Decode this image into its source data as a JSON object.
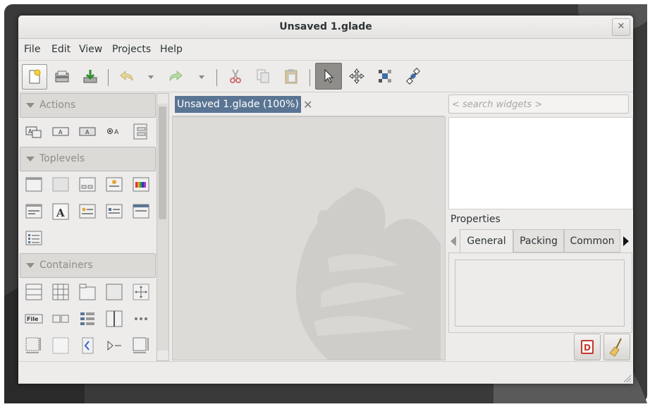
{
  "window": {
    "title": "Unsaved 1.glade",
    "close_glyph": "✕"
  },
  "menu": [
    "File",
    "Edit",
    "View",
    "Projects",
    "Help"
  ],
  "toolbar": {
    "buttons": [
      "new-icon",
      "open-icon",
      "save-icon",
      "undo-icon",
      "redo-icon",
      "cut-icon",
      "copy-icon",
      "paste-icon",
      "select-pointer-icon",
      "drag-resize-icon",
      "margin-edit-icon",
      "alignment-edit-icon"
    ],
    "active": "select-pointer-icon"
  },
  "palette": {
    "sections": [
      {
        "label": "Actions",
        "icons": [
          "action-icon",
          "action-toggle-icon",
          "action-radio-icon",
          "action-recent-icon",
          "action-group-icon"
        ]
      },
      {
        "label": "Toplevels",
        "icons": [
          "window-icon",
          "offscreen-window-icon",
          "dialog-icon",
          "about-dialog-icon",
          "color-chooser-icon",
          "file-chooser-dialog-icon",
          "font-chooser-icon",
          "message-dialog-icon",
          "recent-chooser-icon",
          "assistant-icon",
          "app-chooser-icon"
        ]
      },
      {
        "label": "Containers",
        "icons": [
          "box-icon",
          "grid-icon",
          "notebook-icon",
          "frame-icon",
          "aspect-frame-icon",
          "filename-icon",
          "button-box-icon",
          "toolbar-icon",
          "paned-icon",
          "menubar-icon",
          "layout-icon",
          "viewport-icon",
          "expander-icon",
          "revealer-icon",
          "scrolled-window-icon"
        ]
      }
    ],
    "file_label": "File"
  },
  "workspace": {
    "tab_label": "Unsaved 1.glade (100%)",
    "tab_close": "✕"
  },
  "right": {
    "search_placeholder": "< search widgets >",
    "properties_label": "Properties",
    "tabs": [
      "General",
      "Packing",
      "Common"
    ]
  }
}
